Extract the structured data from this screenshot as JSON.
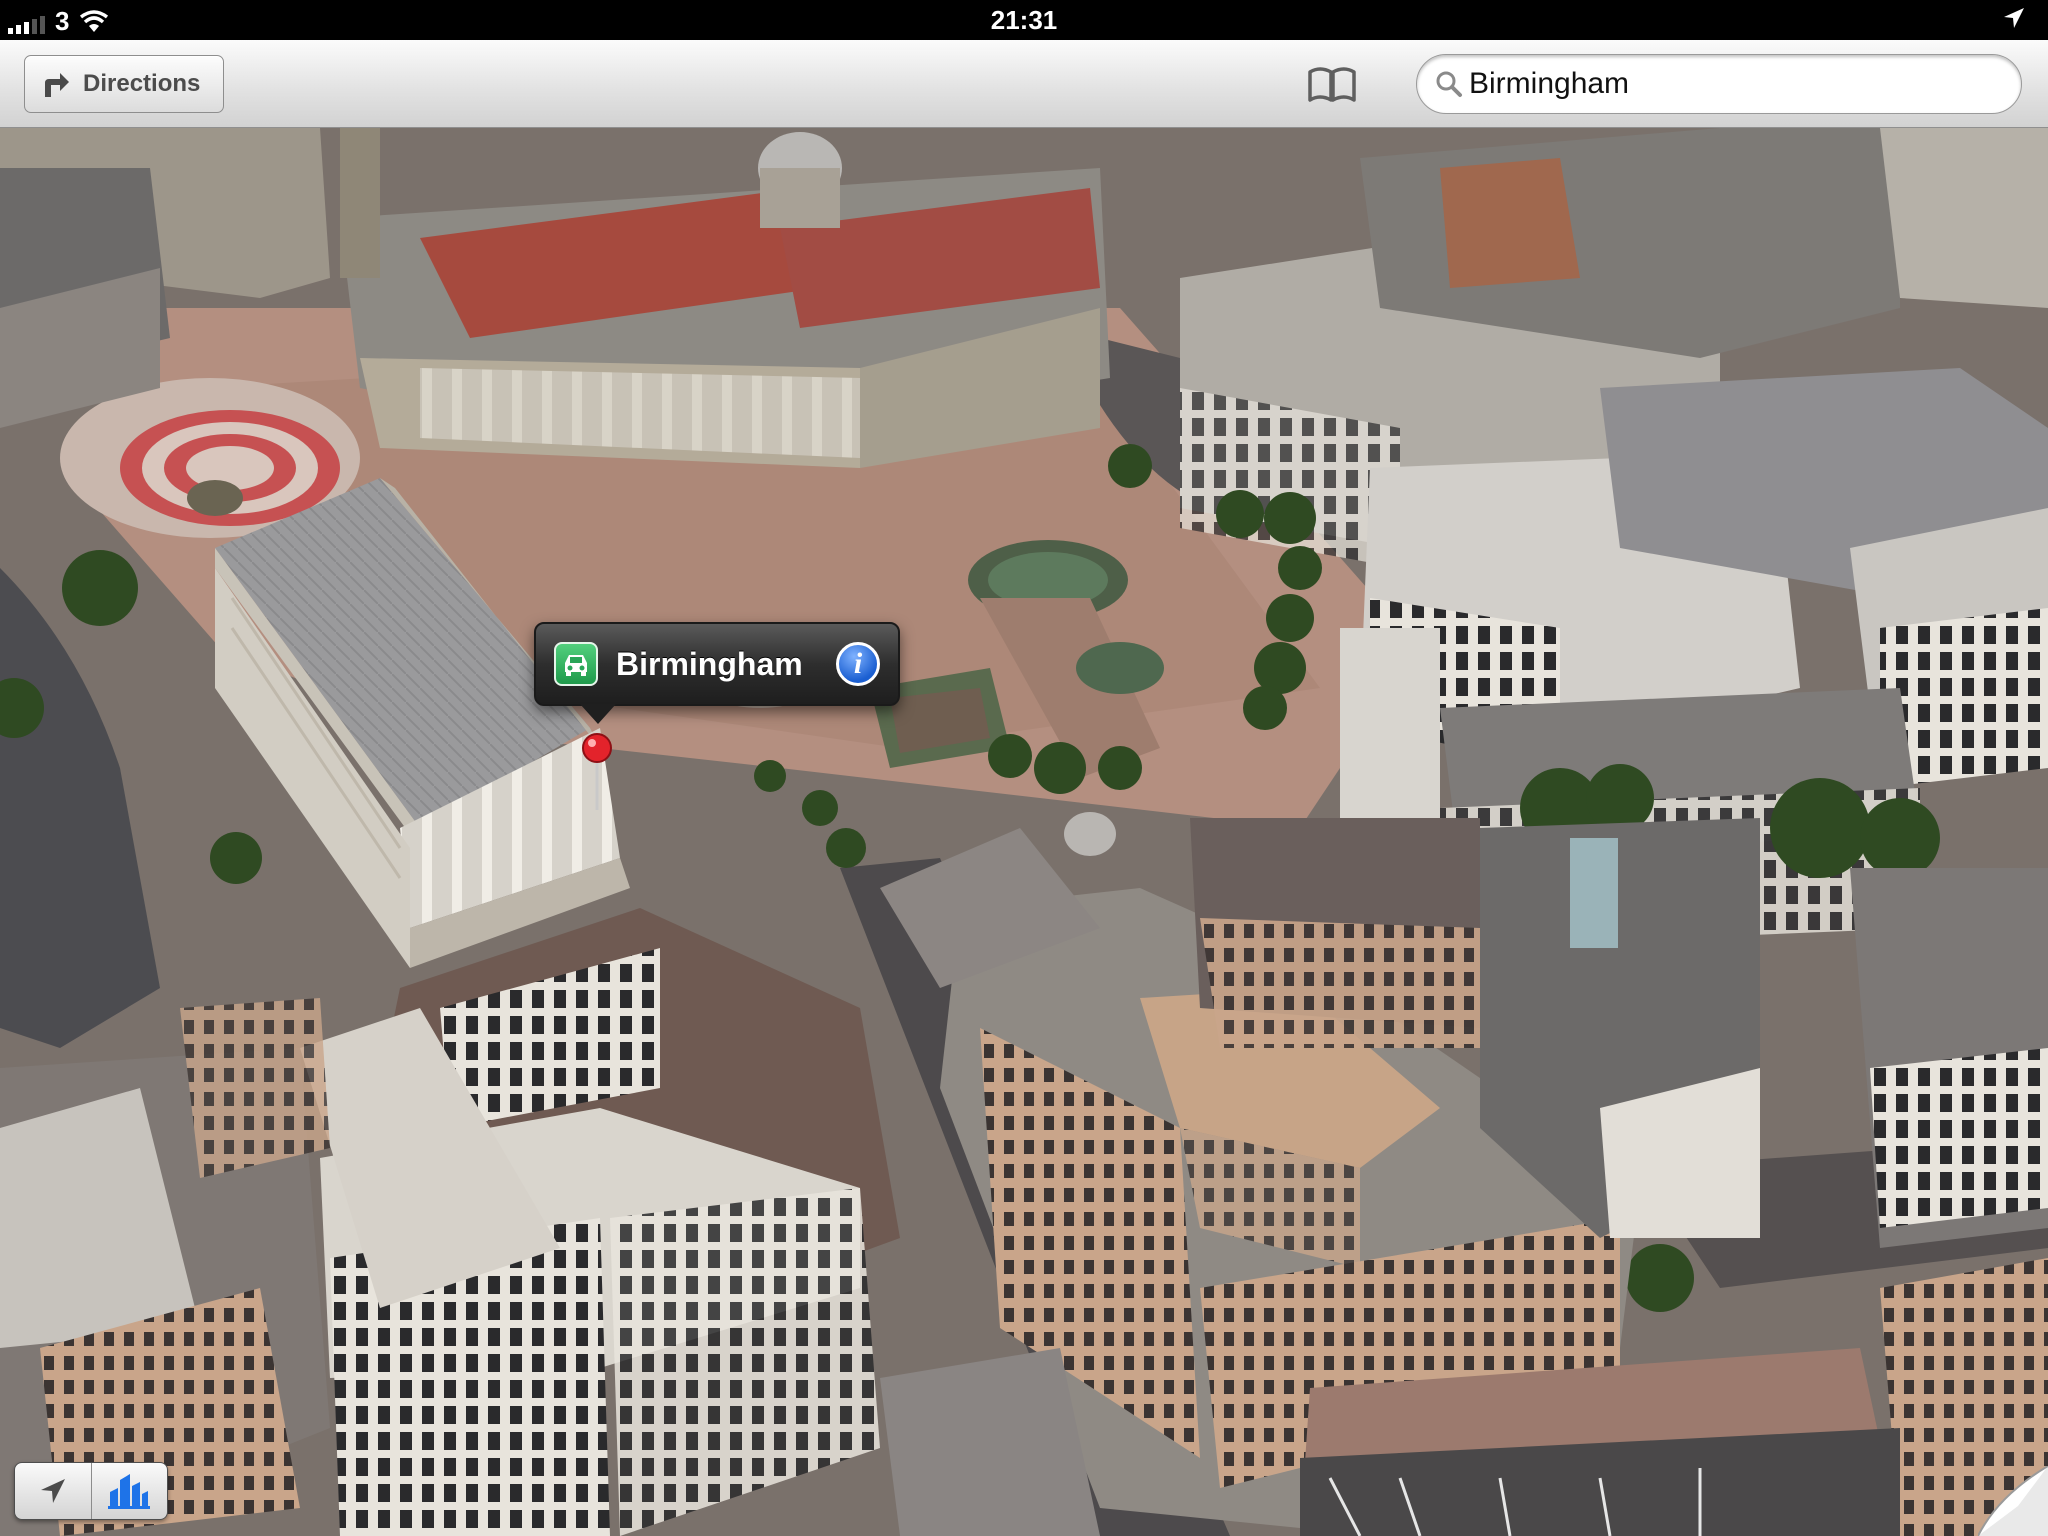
{
  "status_bar": {
    "carrier": "3",
    "time": "21:31"
  },
  "toolbar": {
    "directions_label": "Directions",
    "search_value": "Birmingham"
  },
  "map": {
    "callout_title": "Birmingham"
  },
  "icons": {
    "signal": "signal-strength-icon",
    "wifi": "wifi-icon",
    "location": "location-arrow-icon",
    "directions": "turn-arrow-icon",
    "bookmarks": "book-icon",
    "search": "magnifier-icon",
    "car": "car-icon",
    "info": "info-icon",
    "pin": "map-pin-icon",
    "track": "location-arrow-icon",
    "3d": "buildings-3d-icon",
    "curl": "page-curl-icon"
  },
  "colors": {
    "callout_bg": "#2e2e2e",
    "pin_red": "#e3232b",
    "car_green": "#2fb35b",
    "info_blue": "#1b5fd1",
    "active_blue": "#1e73e8"
  }
}
